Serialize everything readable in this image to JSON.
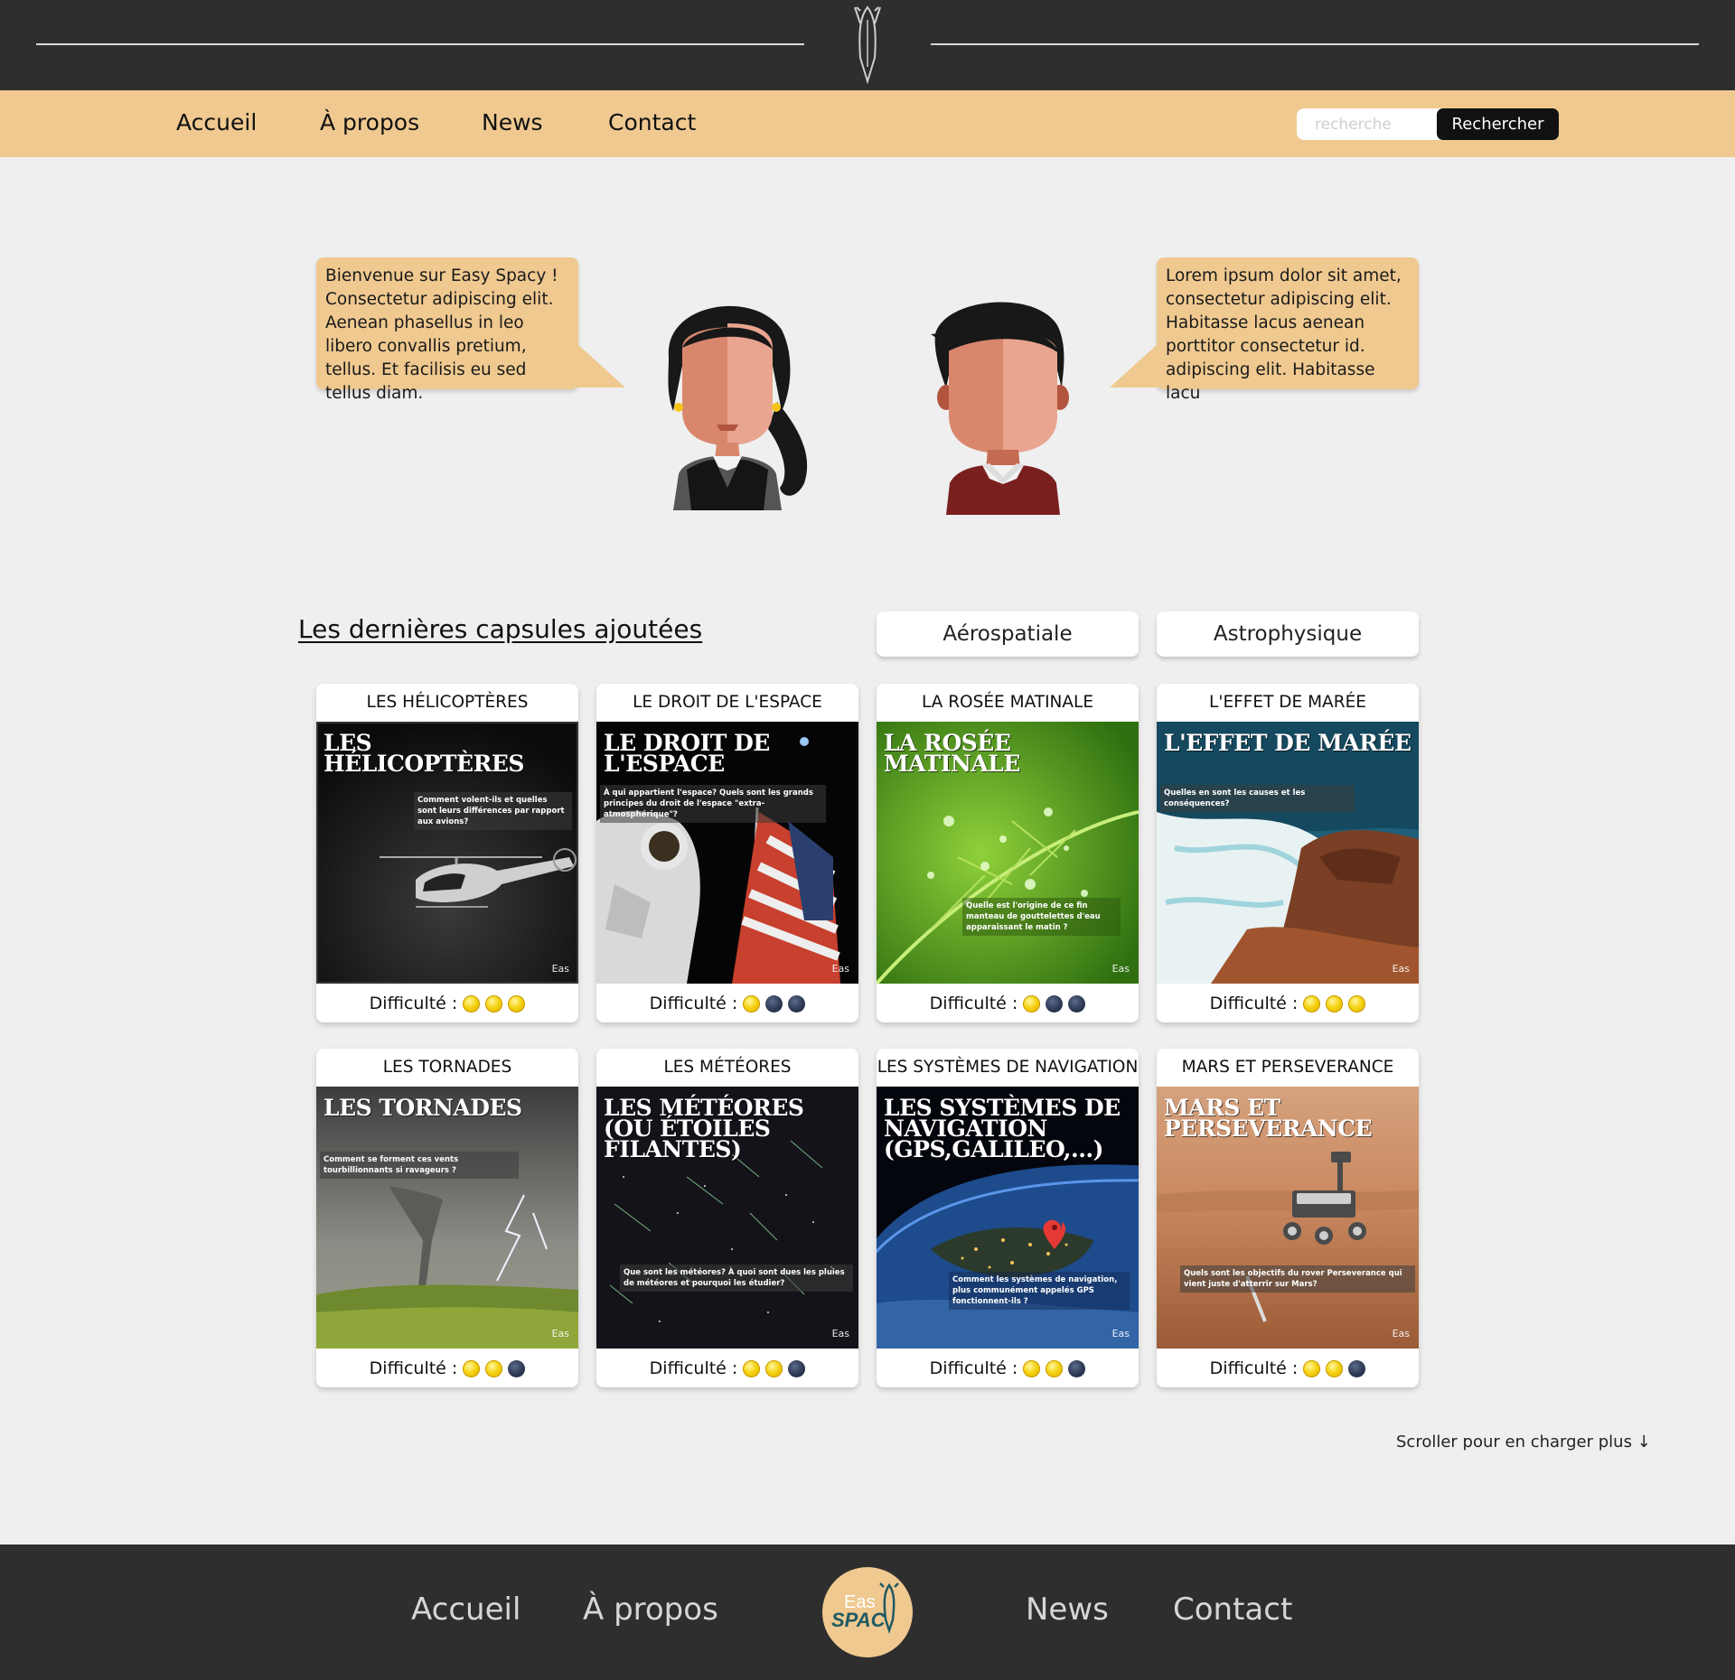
{
  "nav": {
    "links": [
      "Accueil",
      "À propos",
      "News",
      "Contact"
    ],
    "search_placeholder": "recherche",
    "search_button": "Rechercher"
  },
  "hero": {
    "left_bubble": "Bienvenue sur Easy Spacy ! Consectetur adipiscing elit. Aenean phasellus in leo libero convallis pretium, tellus. Et facilisis eu sed tellus diam.",
    "right_bubble": "Lorem ipsum dolor sit amet, consectetur adipiscing elit. Habitasse lacus aenean porttitor consectetur id. adipiscing elit. Habitasse lacu"
  },
  "capsules": {
    "title": "Les dernières capsules ajoutées",
    "filters": [
      "Aérospatiale",
      "Astrophysique"
    ],
    "difficulty_label": "Difficulté :",
    "cards": [
      {
        "title": "LES HÉLICOPTÈRES",
        "poster_title": "Les hélicoptères",
        "question": "Comment volent-ils et quelles sont leurs différences par rapport aux avions?",
        "difficulty": 3
      },
      {
        "title": "LE DROIT DE L'ESPACE",
        "poster_title": "Le droit de l'espace",
        "question": "À qui appartient l'espace? Quels sont les grands principes du droit de l'espace \"extra-atmosphérique\"?",
        "difficulty": 1
      },
      {
        "title": "LA ROSÉE MATINALE",
        "poster_title": "La rosée matinale",
        "question": "Quelle est l'origine de ce fin manteau de gouttelettes d'eau apparaissant le matin ?",
        "difficulty": 1
      },
      {
        "title": "L'EFFET DE MARÉE",
        "poster_title": "L'effet de marée",
        "question": "Quelles en sont les causes et les conséquences?",
        "difficulty": 3
      },
      {
        "title": "LES TORNADES",
        "poster_title": "Les tornades",
        "question": "Comment se forment ces vents tourbillionnants si ravageurs ?",
        "difficulty": 2
      },
      {
        "title": "LES MÉTÉORES",
        "poster_title": "Les météores (ou étoiles filantes)",
        "question": "Que sont les météores? À quoi sont dues les pluies de météores et pourquoi les étudier?",
        "difficulty": 2
      },
      {
        "title": "LES SYSTÈMES DE NAVIGATION",
        "poster_title": "Les systèmes de navigation (GPS,Galileo,...)",
        "question": "Comment les systèmes de navigation, plus communément appelés GPS fonctionnent-ils ?",
        "difficulty": 2
      },
      {
        "title": "MARS ET PERSEVERANCE",
        "poster_title": "Mars et Perseverance",
        "question": "Quels sont les objectifs du rover Perseverance qui vient juste d'atterrir sur Mars?",
        "difficulty": 2
      }
    ],
    "scroll_more": "Scroller pour en charger plus ↓"
  },
  "footer": {
    "links": [
      "Accueil",
      "À propos",
      "News",
      "Contact"
    ],
    "logo_text_top": "Eas",
    "logo_text_bottom": "SPAC"
  },
  "colors": {
    "header_bg": "#2e2e2e",
    "accent": "#efc990",
    "page_bg": "#efefef"
  }
}
